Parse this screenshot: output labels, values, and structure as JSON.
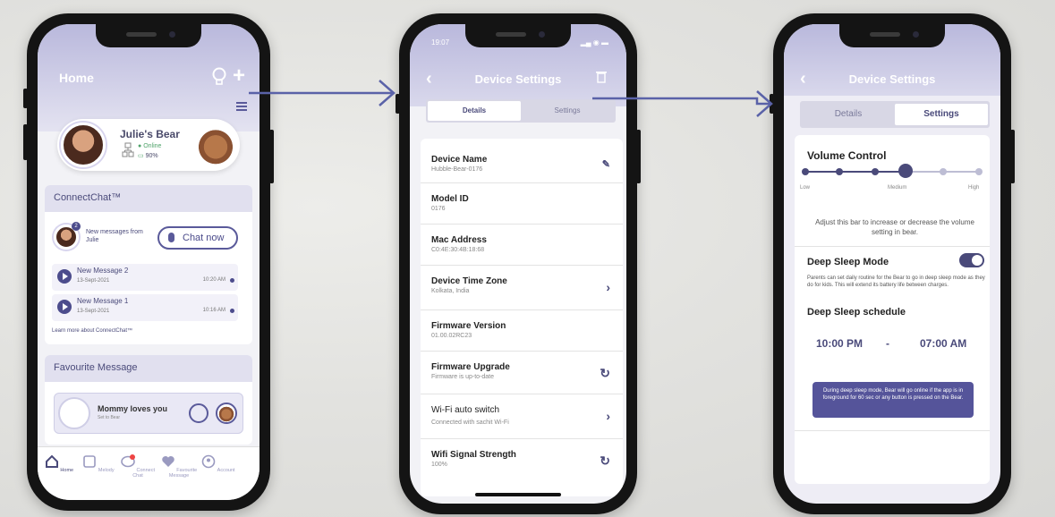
{
  "home_screen": {
    "title": "Home",
    "bear_card": {
      "name": "Julie's Bear",
      "status": "Online",
      "battery": "90%"
    },
    "connectchat": {
      "heading": "ConnectChat™",
      "new_messages_text": "New messages from Julie",
      "badge_count": "2",
      "chat_now_label": "Chat now",
      "messages": [
        {
          "title": "New Message 2",
          "date": "13-Sept-2021",
          "time": "10:20 AM"
        },
        {
          "title": "New Message 1",
          "date": "13-Sept-2021",
          "time": "10:16 AM"
        }
      ],
      "learn_more": "Learn more about ConnectChat™"
    },
    "favourite": {
      "heading": "Favourite Message",
      "message_title": "Mommy loves you",
      "message_sub": "Set to Bear"
    },
    "tabs": [
      {
        "label": "Home",
        "icon": "home-icon"
      },
      {
        "label": "Melody",
        "icon": "music-icon"
      },
      {
        "label": "Connect Chat",
        "icon": "chat-icon",
        "badge": "2"
      },
      {
        "label": "Favourite Message",
        "icon": "heart-icon"
      },
      {
        "label": "Account",
        "icon": "account-icon"
      }
    ]
  },
  "details_screen": {
    "status_time": "19:07",
    "title": "Device Settings",
    "segments": [
      "Details",
      "Settings"
    ],
    "rows": [
      {
        "label": "Device Name",
        "value": "Hubble-Bear-0176",
        "icon": "pencil-icon"
      },
      {
        "label": "Model ID",
        "value": "0176"
      },
      {
        "label": "Mac Address",
        "value": "C0:4E:30:4B:18:68"
      },
      {
        "label": "Device Time Zone",
        "value": "Kolkata, India",
        "icon": "chevron-right-icon"
      },
      {
        "label": "Firmware Version",
        "value": "01.00.02RC23"
      },
      {
        "label": "Firmware Upgrade",
        "value": "Firmware is up-to-date",
        "icon": "refresh-icon"
      },
      {
        "label": "Wi-Fi auto switch",
        "value": "Connected with sachit Wi-Fi",
        "icon": "chevron-right-icon"
      },
      {
        "label": "Wifi Signal Strength",
        "value": "100%",
        "icon": "refresh-icon"
      }
    ]
  },
  "settings_screen": {
    "title": "Device Settings",
    "segments": [
      "Details",
      "Settings"
    ],
    "volume": {
      "title": "Volume Control",
      "labels": [
        "Low",
        "Medium",
        "High"
      ],
      "level": 0.6,
      "description": "Adjust this bar to increase or decrease the volume setting in bear."
    },
    "deep_sleep": {
      "title": "Deep Sleep Mode",
      "enabled": true,
      "description": "Parents can set daily routine for the Bear to go in deep sleep mode as they do for kids. This will extend its battery life between charges.",
      "schedule_title": "Deep Sleep schedule",
      "start": "10:00 PM",
      "separator": "-",
      "end": "07:00 AM",
      "note": "During deep sleep mode, Bear will go online if the app is in foreground for 60 sec or any button is pressed on the Bear."
    }
  },
  "colors": {
    "accent": "#4a4a7a",
    "header": "#b9b8dc",
    "arrow": "#5a62a8"
  }
}
